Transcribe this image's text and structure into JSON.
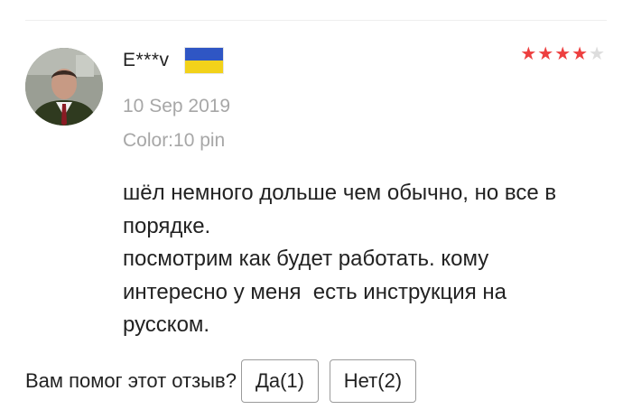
{
  "review": {
    "user_name": "E***v",
    "country_flag": {
      "top_color": "#2f56c4",
      "bottom_color": "#f2d21a",
      "icon": "ukraine-flag-icon"
    },
    "rating": 4,
    "rating_max": 5,
    "star_color": "#ed3f3f",
    "date": "10 Sep 2019",
    "variant": "Color:10 pin",
    "text": "шёл немного дольше чем обычно, но все в\nпорядке.\nпосмотрим как будет работать. кому\nинтересно у меня  есть инструкция на\nрусском."
  },
  "helpful": {
    "question": "Вам помог этот отзыв?",
    "yes_label": "Да(1)",
    "no_label": "Нет(2)"
  }
}
